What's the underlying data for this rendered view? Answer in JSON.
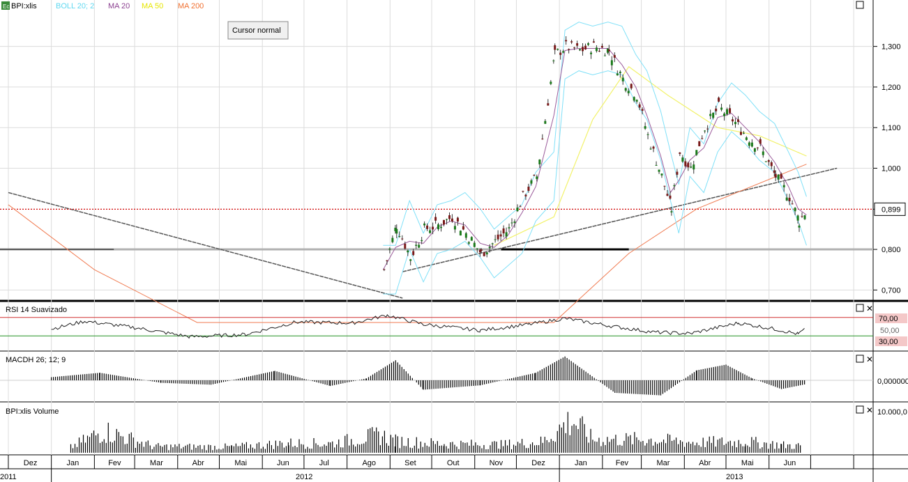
{
  "header": {
    "symbol": "BPI:xlis",
    "indicators": [
      {
        "label": "BOLL 20; 2",
        "color": "#5fd8f0"
      },
      {
        "label": "MA 20",
        "color": "#8a3f8f"
      },
      {
        "label": "MA 50",
        "color": "#e6e600"
      },
      {
        "label": "MA 200",
        "color": "#f07030"
      }
    ],
    "tooltip": "Cursor normal"
  },
  "colors": {
    "price_up": "#1a7a1a",
    "price_down": "#7a1a1a",
    "boll": "#7fe0f8",
    "ma20": "#9a5a9a",
    "ma50": "#f2f26a",
    "ma200": "#f07a50",
    "trend": "#808080",
    "support": "#000000",
    "current_line": "#d00000",
    "rsi_line": "#202020",
    "rsi_upper": "#d03030",
    "rsi_lower": "#209020"
  },
  "panels": {
    "rsi": {
      "title": "RSI 14 Suavizado",
      "upper_label": "70,00",
      "lower_label": "30,00",
      "mid_label": "50,00"
    },
    "macd": {
      "title": "MACDH 26; 12; 9",
      "zero_label": "0,000000"
    },
    "volume": {
      "title": "BPI:xlis Volume",
      "top_label": "10.000,0"
    }
  },
  "chart_data": [
    {
      "type": "candlestick",
      "title": "BPI:xlis",
      "ylim": [
        0.68,
        1.38
      ],
      "yticks": [
        "0,700",
        "0,800",
        "0,899",
        "1,000",
        "1,100",
        "1,200",
        "1,300"
      ],
      "current_price": "0,899",
      "months": [
        "Dez",
        "Jan",
        "Fev",
        "Mar",
        "Abr",
        "Mai",
        "Jun",
        "Jul",
        "Ago",
        "Set",
        "Out",
        "Nov",
        "Dez",
        "Jan",
        "Fev",
        "Mar",
        "Abr",
        "Mai",
        "Jun"
      ],
      "years": [
        "2011",
        "2012",
        "2013"
      ],
      "close_series": {
        "x": [
          "2012-08-27",
          "2012-09-05",
          "2012-09-15",
          "2012-09-25",
          "2012-10-05",
          "2012-10-15",
          "2012-10-25",
          "2012-11-05",
          "2012-11-15",
          "2012-11-25",
          "2012-12-05",
          "2012-12-15",
          "2012-12-28",
          "2013-01-05",
          "2013-01-15",
          "2013-01-25",
          "2013-02-05",
          "2013-02-15",
          "2013-02-25",
          "2013-03-05",
          "2013-03-15",
          "2013-03-22",
          "2013-03-28",
          "2013-04-05",
          "2013-04-15",
          "2013-04-25",
          "2013-05-05",
          "2013-05-15",
          "2013-05-25",
          "2013-06-05",
          "2013-06-15",
          "2013-06-22",
          "2013-06-28"
        ],
        "y": [
          0.75,
          0.86,
          0.78,
          0.85,
          0.86,
          0.88,
          0.84,
          0.79,
          0.82,
          0.85,
          0.93,
          0.98,
          1.28,
          1.3,
          1.29,
          1.3,
          1.29,
          1.22,
          1.18,
          1.08,
          0.98,
          0.9,
          1.04,
          1.0,
          1.1,
          1.15,
          1.12,
          1.08,
          1.05,
          0.98,
          0.93,
          0.87,
          0.9
        ]
      },
      "ma200": {
        "x": [
          "2011-12-01",
          "2012-02-01",
          "2012-04-15",
          "2012-12-28",
          "2013-02-20",
          "2013-04-10",
          "2013-06-28"
        ],
        "y": [
          0.91,
          0.75,
          0.62,
          0.62,
          0.79,
          0.9,
          1.01
        ]
      },
      "ma50": {
        "x": [
          "2012-11-15",
          "2012-12-28",
          "2013-01-25",
          "2013-02-20",
          "2013-03-20",
          "2013-04-25",
          "2013-05-25",
          "2013-06-28"
        ],
        "y": [
          0.81,
          0.88,
          1.12,
          1.25,
          1.18,
          1.1,
          1.08,
          1.03
        ]
      },
      "support_level": 0.8,
      "trend_lines": [
        {
          "x": [
            "2011-12-01",
            "2012-09-10"
          ],
          "y": [
            0.94,
            0.68
          ]
        },
        {
          "x": [
            "2012-09-10",
            "2013-07-20"
          ],
          "y": [
            0.745,
            1.0
          ]
        }
      ]
    },
    {
      "type": "line",
      "title": "RSI 14 Suavizado",
      "ylim": [
        0,
        100
      ],
      "levels": [
        70,
        30
      ],
      "x": [
        "2012-01-01",
        "2012-01-25",
        "2012-03-01",
        "2012-04-10",
        "2012-05-20",
        "2012-06-25",
        "2012-08-05",
        "2012-08-30",
        "2012-09-25",
        "2012-11-05",
        "2012-12-10",
        "2013-01-05",
        "2013-02-10",
        "2013-03-10",
        "2013-04-05",
        "2013-05-10",
        "2013-06-05",
        "2013-06-22",
        "2013-06-28"
      ],
      "y": [
        45,
        62,
        48,
        28,
        33,
        60,
        58,
        75,
        55,
        42,
        55,
        68,
        50,
        38,
        35,
        58,
        45,
        34,
        47
      ]
    },
    {
      "type": "bar",
      "title": "MACDH 26; 12; 9",
      "x": [
        "2012-01-01",
        "2012-02-05",
        "2012-03-20",
        "2012-04-25",
        "2012-06-10",
        "2012-07-20",
        "2012-08-15",
        "2012-09-05",
        "2012-09-25",
        "2012-11-05",
        "2012-12-15",
        "2013-01-05",
        "2013-02-10",
        "2013-03-15",
        "2013-04-10",
        "2013-05-01",
        "2013-05-20",
        "2013-06-10",
        "2013-06-28"
      ],
      "y": [
        0.5,
        1.2,
        -0.4,
        -0.7,
        1.5,
        -0.9,
        0.3,
        3.2,
        -1.5,
        -0.8,
        1.2,
        3.8,
        -2.0,
        -2.4,
        1.6,
        2.5,
        0.3,
        -1.4,
        -0.6
      ]
    },
    {
      "type": "bar",
      "title": "BPI:xlis Volume",
      "x": [
        "2012-01-15",
        "2012-02-08",
        "2012-03-15",
        "2012-05-10",
        "2012-06-20",
        "2012-07-20",
        "2012-08-25",
        "2012-09-05",
        "2012-10-10",
        "2012-11-20",
        "2012-12-20",
        "2013-01-10",
        "2013-01-25",
        "2013-03-05",
        "2013-04-10",
        "2013-05-15",
        "2013-06-10",
        "2013-06-25"
      ],
      "y": [
        1500,
        6000,
        1700,
        1600,
        2600,
        2500,
        4800,
        3200,
        2400,
        2200,
        3000,
        9000,
        3600,
        3600,
        2800,
        3000,
        2100,
        1800
      ]
    }
  ]
}
